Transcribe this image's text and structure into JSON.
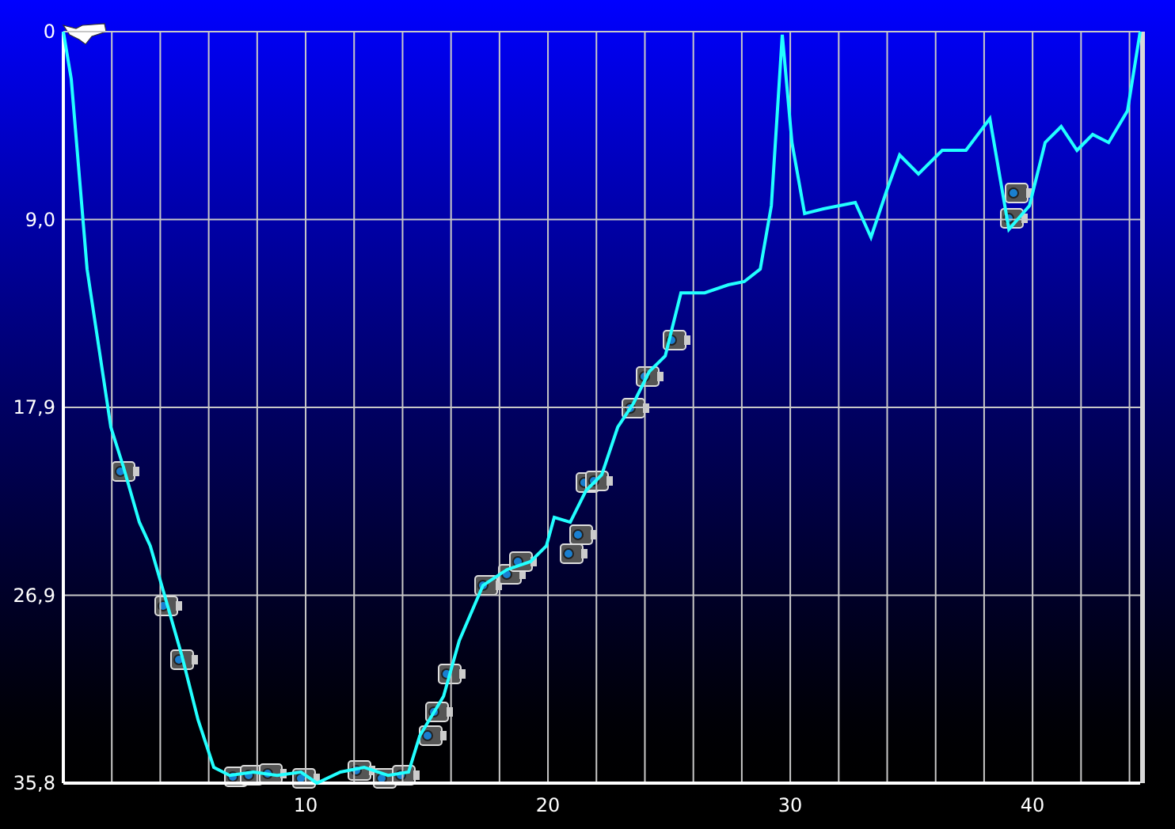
{
  "chart_data": {
    "type": "line",
    "x": [
      0,
      0.33,
      0.98,
      1.96,
      2.48,
      3.14,
      3.59,
      4.25,
      4.9,
      5.56,
      6.21,
      6.86,
      7.84,
      8.82,
      9.8,
      10.46,
      11.44,
      12.42,
      13.4,
      14.25,
      14.71,
      15.69,
      16.34,
      17.32,
      18.3,
      19.28,
      19.93,
      20.26,
      20.92,
      21.57,
      22.22,
      22.88,
      23.53,
      24.18,
      24.84,
      25.49,
      26.47,
      27.45,
      28.1,
      28.76,
      29.22,
      29.67,
      30.07,
      30.59,
      31.37,
      32.68,
      33.33,
      33.99,
      34.51,
      35.29,
      36.27,
      37.25,
      38.24,
      39.02,
      39.87,
      40.52,
      41.18,
      41.83,
      42.48,
      43.14,
      43.92,
      44.44
    ],
    "grid": true,
    "series": [
      {
        "color": "#22ffff",
        "values": [
          0,
          2.26,
          11.31,
          18.84,
          20.73,
          23.37,
          24.5,
          27.13,
          29.77,
          32.79,
          35.05,
          35.43,
          35.27,
          35.43,
          35.27,
          35.8,
          35.27,
          35.05,
          35.43,
          35.27,
          33.54,
          31.66,
          29.02,
          26.38,
          25.63,
          25.25,
          24.5,
          23.14,
          23.37,
          21.86,
          21.11,
          18.84,
          17.71,
          16.2,
          15.45,
          12.44,
          12.44,
          12.06,
          11.91,
          11.31,
          8.29,
          0.15,
          5.28,
          8.67,
          8.44,
          8.14,
          9.8,
          7.54,
          5.88,
          6.78,
          5.65,
          5.65,
          4.14,
          9.42,
          8.29,
          5.28,
          4.52,
          5.65,
          4.9,
          5.28,
          3.77,
          0
        ]
      }
    ],
    "xlim": [
      0,
      44.44
    ],
    "ylim": [
      35.8,
      0
    ],
    "xticks": [
      {
        "value": 10,
        "label": "10"
      },
      {
        "value": 20,
        "label": "20"
      },
      {
        "value": 30,
        "label": "30"
      },
      {
        "value": 40,
        "label": "40"
      }
    ],
    "yticks": [
      {
        "value": 0,
        "label": "0"
      },
      {
        "value": 8.95,
        "label": "9,0"
      },
      {
        "value": 17.9,
        "label": "17,9"
      },
      {
        "value": 26.85,
        "label": "26,9"
      },
      {
        "value": 35.8,
        "label": "35,8"
      }
    ]
  }
}
